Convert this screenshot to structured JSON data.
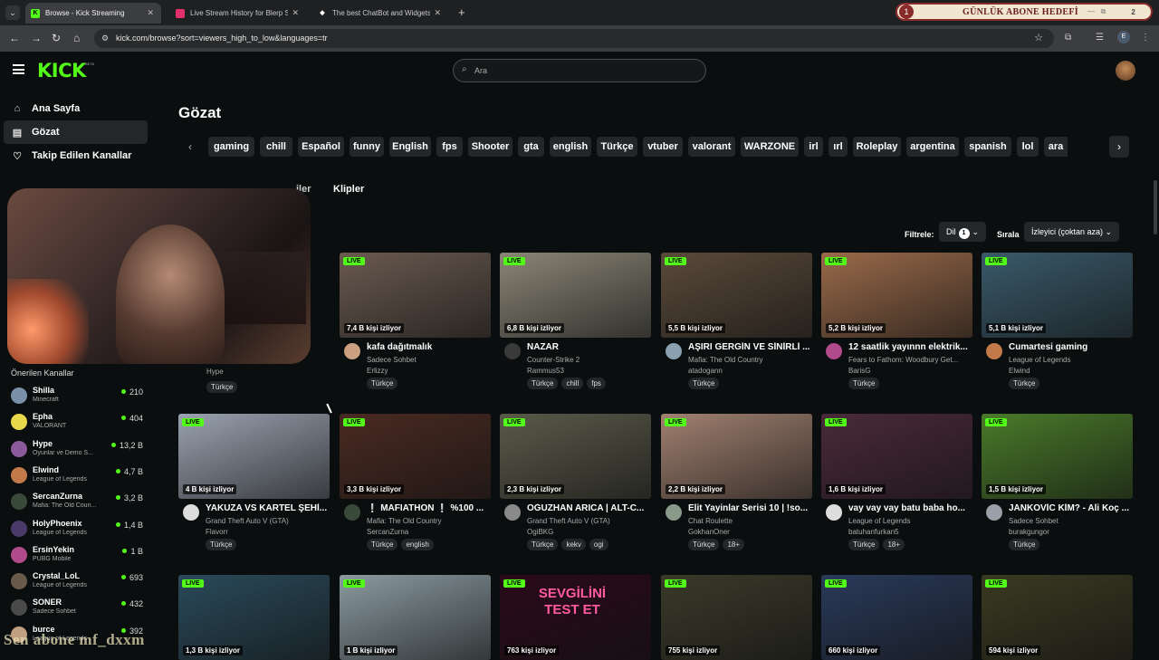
{
  "browser": {
    "tabs": [
      {
        "title": "Browse - Kick Streaming",
        "fav": "K",
        "fav_color": "#53fc18",
        "active": true
      },
      {
        "title": "Live Stream History for Blerp St",
        "fav": "",
        "fav_color": "#e3306c",
        "active": false
      },
      {
        "title": "The best ChatBot and Widgets",
        "fav": "◆",
        "fav_color": "#ffffff",
        "active": false
      }
    ],
    "url": "kick.com/browse?sort=viewers_high_to_low&languages=tr",
    "profile_letter": "E"
  },
  "overlay": {
    "sub_goal_number": "1",
    "sub_goal_text": "GÜNLÜK ABONE HEDEFİ",
    "sub_goal_count": "2",
    "watermark": "Sen abone mf_dxxm"
  },
  "kick": {
    "logo": "KICK",
    "beta": "BETA",
    "search_placeholder": "Ara",
    "nav": [
      {
        "label": "Ana Sayfa",
        "icon": "home-icon"
      },
      {
        "label": "Gözat",
        "icon": "browse-icon"
      },
      {
        "label": "Takip Edilen Kanallar",
        "icon": "heart-icon"
      }
    ],
    "recommended_title": "Önerilen Kanallar",
    "recommended": [
      {
        "name": "Shilla",
        "game": "Minecraft",
        "viewers": "210",
        "color": "#7a8fa8"
      },
      {
        "name": "Epha",
        "game": "VALORANT",
        "viewers": "404",
        "color": "#e7d74a"
      },
      {
        "name": "Hype",
        "game": "Oyunlar ve Demo S...",
        "viewers": "13,2 B",
        "color": "#8a5a9a"
      },
      {
        "name": "Elwind",
        "game": "League of Legends",
        "viewers": "4,7 B",
        "color": "#c27a4a"
      },
      {
        "name": "SercanZurna",
        "game": "Mafia: The Old Coun...",
        "viewers": "3,2 B",
        "color": "#3a4a3a"
      },
      {
        "name": "HolyPhoenix",
        "game": "League of Legends",
        "viewers": "1,4 B",
        "color": "#4a3a6a"
      },
      {
        "name": "ErsinYekin",
        "game": "PUBG Mobile",
        "viewers": "1 B",
        "color": "#b04a8a"
      },
      {
        "name": "Crystal_LoL",
        "game": "League of Legends",
        "viewers": "693",
        "color": "#6a5a4a"
      },
      {
        "name": "SONER",
        "game": "Sadece Sohbet",
        "viewers": "432",
        "color": "#4a4a4a"
      },
      {
        "name": "burce",
        "game": "League of Legends",
        "viewers": "392",
        "color": "#c0a080"
      }
    ],
    "page_title": "Gözat",
    "tags": [
      "gaming",
      "chill",
      "Español",
      "funny",
      "English",
      "fps",
      "Shooter",
      "gta",
      "english",
      "Türkçe",
      "vtuber",
      "valorant",
      "WARZONE",
      "irl",
      "ırl",
      "Roleplay",
      "argentina",
      "spanish",
      "lol",
      "ara"
    ],
    "subtabs": [
      "iler",
      "Klipler"
    ],
    "filter_label": "Filtrele:",
    "lang_label": "Dil",
    "lang_count": "1",
    "sort_label": "Sırala",
    "sort_value": "İzleyici (çoktan aza)",
    "hidden_card_stub": {
      "streamer": "Hype",
      "chips": [
        "Türkçe"
      ]
    },
    "streams": [
      {
        "title": "kafa dağıtmalık",
        "category": "Sadece Sohbet",
        "streamer": "Erlizzy",
        "viewers": "7,4 B kişi izliyor",
        "chips": [
          "Türkçe"
        ],
        "thumb": "#6a5a50",
        "av": "#caa080"
      },
      {
        "title": "NAZAR",
        "category": "Counter-Strike 2",
        "streamer": "Rammus53",
        "viewers": "6,8 B kişi izliyor",
        "chips": [
          "Türkçe",
          "chill",
          "fps"
        ],
        "thumb": "#8a8576",
        "av": "#3a3a3a"
      },
      {
        "title": "AŞIRI GERGİN VE SİNİRLİ ...",
        "category": "Mafia: The Old Country",
        "streamer": "atadogann",
        "viewers": "5,5 B kişi izliyor",
        "chips": [
          "Türkçe"
        ],
        "thumb": "#5a4a3a",
        "av": "#8aa0b0"
      },
      {
        "title": "12 saatlik yayınnn elektrik...",
        "category": "Fears to Fathom: Woodbury Get...",
        "streamer": "BarisG",
        "viewers": "5,2 B kişi izliyor",
        "chips": [
          "Türkçe"
        ],
        "thumb": "#9a6a4a",
        "av": "#b04a8a"
      },
      {
        "title": "Cumartesi gaming",
        "category": "League of Legends",
        "streamer": "Elwind",
        "viewers": "5,1 B kişi izliyor",
        "chips": [
          "Türkçe"
        ],
        "thumb": "#3a5a6a",
        "av": "#c27a4a"
      },
      {
        "title": "YAKUZA VS KARTEL ŞEHİ...",
        "category": "Grand Theft Auto V (GTA)",
        "streamer": "Flavorr",
        "viewers": "4 B kişi izliyor",
        "chips": [
          "Türkçe"
        ],
        "thumb": "#9aa2b0",
        "av": "#dddddd"
      },
      {
        "title": "❕ MAFIATHON ❕ %100 ...",
        "category": "Mafia: The Old Country",
        "streamer": "SercanZurna",
        "viewers": "3,3 B kişi izliyor",
        "chips": [
          "Türkçe",
          "english"
        ],
        "thumb": "#4a2a22",
        "av": "#3a4a3a"
      },
      {
        "title": "OĞUZHAN ARICA | ALT-C...",
        "category": "Grand Theft Auto V (GTA)",
        "streamer": "OgiBKG",
        "viewers": "2,3 B kişi izliyor",
        "chips": [
          "Türkçe",
          "kekv",
          "ogi"
        ],
        "thumb": "#5a5a4a",
        "av": "#8a8a8a"
      },
      {
        "title": "Elit Yayinlar Serisi 10 | !so...",
        "category": "Chat Roulette",
        "streamer": "GokhanOner",
        "viewers": "2,2 B kişi izliyor",
        "chips": [
          "Türkçe",
          "18+"
        ],
        "thumb": "#a08070",
        "av": "#8a9a8a"
      },
      {
        "title": "vay vay vay batu baba ho...",
        "category": "League of Legends",
        "streamer": "batuhanfurkan5",
        "viewers": "1,6 B kişi izliyor",
        "chips": [
          "Türkçe",
          "18+"
        ],
        "thumb": "#4a2a3a",
        "av": "#dddddd"
      },
      {
        "title": "JANKOVİC KİM? - Ali Koç ...",
        "category": "Sadece Sohbet",
        "streamer": "burakgungor",
        "viewers": "1,5 B kişi izliyor",
        "chips": [
          "Türkçe"
        ],
        "thumb": "#4a7a2a",
        "av": "#9aa0a8"
      },
      {
        "title": "",
        "category": "",
        "streamer": "",
        "viewers": "1,3 B kişi izliyor",
        "chips": [],
        "thumb": "#2a4a5a",
        "av": "#000"
      },
      {
        "title": "",
        "category": "",
        "streamer": "",
        "viewers": "1 B kişi izliyor",
        "chips": [],
        "thumb": "#8a9aa0",
        "av": "#000"
      },
      {
        "title": "",
        "category": "",
        "streamer": "",
        "viewers": "763 kişi izliyor",
        "chips": [],
        "thumb": "#2a0a1a",
        "av": "#000",
        "overlay_text": "SEVGİLİNİ TEST ET"
      },
      {
        "title": "",
        "category": "",
        "streamer": "",
        "viewers": "755 kişi izliyor",
        "chips": [],
        "thumb": "#3a3a2a",
        "av": "#000"
      },
      {
        "title": "",
        "category": "",
        "streamer": "",
        "viewers": "660 kişi izliyor",
        "chips": [],
        "thumb": "#2a3a5a",
        "av": "#000"
      },
      {
        "title": "",
        "category": "",
        "streamer": "",
        "viewers": "594 kişi izliyor",
        "chips": [],
        "thumb": "#3a3a22",
        "av": "#000"
      }
    ],
    "live_label": "LIVE"
  }
}
